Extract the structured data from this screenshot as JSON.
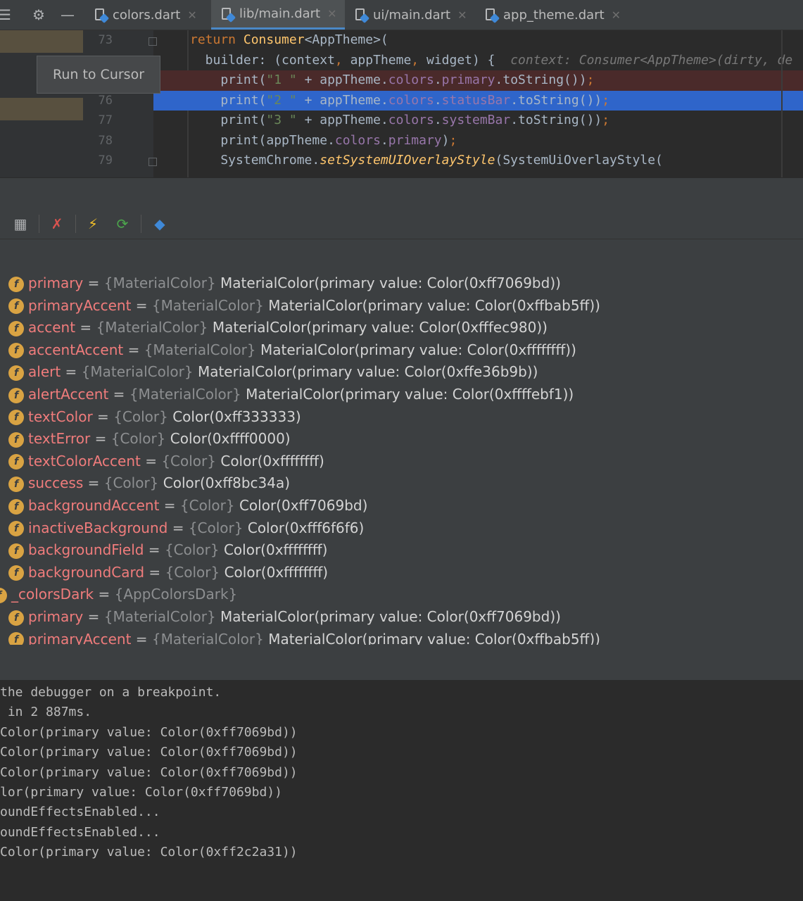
{
  "tabs": [
    {
      "label": "colors.dart",
      "active": false
    },
    {
      "label": "lib/main.dart",
      "active": true
    },
    {
      "label": "ui/main.dart",
      "active": false
    },
    {
      "label": "app_theme.dart",
      "active": false
    }
  ],
  "toolbar_icons": [
    "collapse-icon",
    "gear-icon",
    "minimize-icon"
  ],
  "editor": {
    "line_numbers": [
      "73",
      "",
      "",
      "76",
      "77",
      "78",
      "79"
    ],
    "hint": "context: Consumer<AppTheme>(dirty, de",
    "lines": [
      {
        "parts": [
          {
            "t": "return ",
            "c": "kw"
          },
          {
            "t": "Consumer",
            "c": "cls"
          },
          {
            "t": "<AppTheme>(",
            "c": ""
          }
        ]
      },
      {
        "parts": [
          {
            "t": "  builder: (context",
            "c": ""
          },
          {
            "t": ", ",
            "c": "kw"
          },
          {
            "t": "appTheme",
            "c": ""
          },
          {
            "t": ", ",
            "c": "kw"
          },
          {
            "t": "widget) {  ",
            "c": ""
          }
        ]
      },
      {
        "parts": [
          {
            "t": "    print(",
            "c": ""
          },
          {
            "t": "\"1 \"",
            "c": "str"
          },
          {
            "t": " + appTheme.",
            "c": ""
          },
          {
            "t": "colors",
            "c": "fld"
          },
          {
            "t": ".",
            "c": ""
          },
          {
            "t": "primary",
            "c": "fld"
          },
          {
            "t": ".toString())",
            "c": ""
          },
          {
            "t": ";",
            "c": "kw"
          }
        ]
      },
      {
        "parts": [
          {
            "t": "    print(",
            "c": ""
          },
          {
            "t": "\"2 \"",
            "c": "str"
          },
          {
            "t": " + appTheme.",
            "c": ""
          },
          {
            "t": "colors",
            "c": "fld"
          },
          {
            "t": ".",
            "c": ""
          },
          {
            "t": "statusBar",
            "c": "fld"
          },
          {
            "t": ".toString())",
            "c": ""
          },
          {
            "t": ";",
            "c": "kw"
          }
        ]
      },
      {
        "parts": [
          {
            "t": "    print(",
            "c": ""
          },
          {
            "t": "\"3 \"",
            "c": "str"
          },
          {
            "t": " + appTheme.",
            "c": ""
          },
          {
            "t": "colors",
            "c": "fld"
          },
          {
            "t": ".",
            "c": ""
          },
          {
            "t": "systemBar",
            "c": "fld"
          },
          {
            "t": ".toString())",
            "c": ""
          },
          {
            "t": ";",
            "c": "kw"
          }
        ]
      },
      {
        "parts": [
          {
            "t": "    print(appTheme.",
            "c": ""
          },
          {
            "t": "colors",
            "c": "fld"
          },
          {
            "t": ".",
            "c": ""
          },
          {
            "t": "primary",
            "c": "fld"
          },
          {
            "t": ")",
            "c": ""
          },
          {
            "t": ";",
            "c": "kw"
          }
        ]
      },
      {
        "parts": [
          {
            "t": "    SystemChrome.",
            "c": ""
          },
          {
            "t": "setSystemUIOverlayStyle",
            "c": "fn"
          },
          {
            "t": "(SystemUiOverlayStyle(",
            "c": ""
          }
        ]
      }
    ],
    "tooltip": "Run to Cursor"
  },
  "debug_toolbar": [
    "calculator-icon",
    "clear-breakpoints-icon",
    "lightning-icon",
    "hot-reload-icon",
    "dart-devtools-icon"
  ],
  "variables": [
    {
      "name": "primary",
      "type": "{MaterialColor}",
      "value": "MaterialColor(primary value: Color(0xff7069bd))",
      "indent": true
    },
    {
      "name": "primaryAccent",
      "type": "{MaterialColor}",
      "value": "MaterialColor(primary value: Color(0xffbab5ff))",
      "indent": true
    },
    {
      "name": "accent",
      "type": "{MaterialColor}",
      "value": "MaterialColor(primary value: Color(0xfffec980))",
      "indent": true
    },
    {
      "name": "accentAccent",
      "type": "{MaterialColor}",
      "value": "MaterialColor(primary value: Color(0xffffffff))",
      "indent": true
    },
    {
      "name": "alert",
      "type": "{MaterialColor}",
      "value": "MaterialColor(primary value: Color(0xffe36b9b))",
      "indent": true
    },
    {
      "name": "alertAccent",
      "type": "{MaterialColor}",
      "value": "MaterialColor(primary value: Color(0xffffebf1))",
      "indent": true
    },
    {
      "name": "textColor",
      "type": "{Color}",
      "value": "Color(0xff333333)",
      "indent": true
    },
    {
      "name": "textError",
      "type": "{Color}",
      "value": "Color(0xffff0000)",
      "indent": true
    },
    {
      "name": "textColorAccent",
      "type": "{Color}",
      "value": "Color(0xffffffff)",
      "indent": true
    },
    {
      "name": "success",
      "type": "{Color}",
      "value": "Color(0xff8bc34a)",
      "indent": true
    },
    {
      "name": "backgroundAccent",
      "type": "{Color}",
      "value": "Color(0xff7069bd)",
      "indent": true
    },
    {
      "name": "inactiveBackground",
      "type": "{Color}",
      "value": "Color(0xfff6f6f6)",
      "indent": true
    },
    {
      "name": "backgroundField",
      "type": "{Color}",
      "value": "Color(0xffffffff)",
      "indent": true
    },
    {
      "name": "backgroundCard",
      "type": "{Color}",
      "value": "Color(0xffffffff)",
      "indent": true
    },
    {
      "name": "_colorsDark",
      "type": "{AppColorsDark}",
      "value": "",
      "indent": false
    },
    {
      "name": "primary",
      "type": "{MaterialColor}",
      "value": "MaterialColor(primary value: Color(0xff7069bd))",
      "indent": true
    },
    {
      "name": "primaryAccent",
      "type": "{MaterialColor}",
      "value": "MaterialColor(primary value: Color(0xffbab5ff))",
      "indent": true
    }
  ],
  "console": [
    "the debugger on a breakpoint.",
    " in 2 887ms.",
    "Color(primary value: Color(0xff7069bd))",
    "Color(primary value: Color(0xff7069bd))",
    "Color(primary value: Color(0xff7069bd))",
    "lor(primary value: Color(0xff7069bd))",
    "oundEffectsEnabled...",
    "oundEffectsEnabled...",
    "Color(primary value: Color(0xff2c2a31))"
  ]
}
